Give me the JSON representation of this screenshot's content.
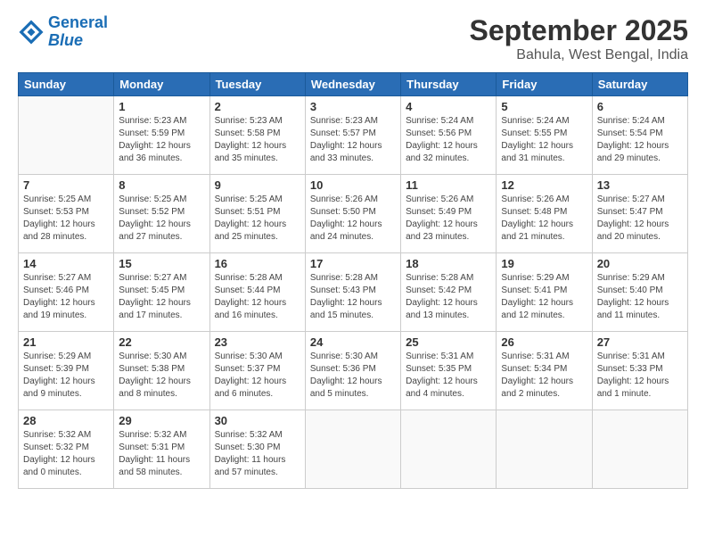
{
  "header": {
    "logo_line1": "General",
    "logo_line2": "Blue",
    "title": "September 2025",
    "subtitle": "Bahula, West Bengal, India"
  },
  "weekdays": [
    "Sunday",
    "Monday",
    "Tuesday",
    "Wednesday",
    "Thursday",
    "Friday",
    "Saturday"
  ],
  "weeks": [
    [
      {
        "num": "",
        "info": ""
      },
      {
        "num": "1",
        "info": "Sunrise: 5:23 AM\nSunset: 5:59 PM\nDaylight: 12 hours\nand 36 minutes."
      },
      {
        "num": "2",
        "info": "Sunrise: 5:23 AM\nSunset: 5:58 PM\nDaylight: 12 hours\nand 35 minutes."
      },
      {
        "num": "3",
        "info": "Sunrise: 5:23 AM\nSunset: 5:57 PM\nDaylight: 12 hours\nand 33 minutes."
      },
      {
        "num": "4",
        "info": "Sunrise: 5:24 AM\nSunset: 5:56 PM\nDaylight: 12 hours\nand 32 minutes."
      },
      {
        "num": "5",
        "info": "Sunrise: 5:24 AM\nSunset: 5:55 PM\nDaylight: 12 hours\nand 31 minutes."
      },
      {
        "num": "6",
        "info": "Sunrise: 5:24 AM\nSunset: 5:54 PM\nDaylight: 12 hours\nand 29 minutes."
      }
    ],
    [
      {
        "num": "7",
        "info": "Sunrise: 5:25 AM\nSunset: 5:53 PM\nDaylight: 12 hours\nand 28 minutes."
      },
      {
        "num": "8",
        "info": "Sunrise: 5:25 AM\nSunset: 5:52 PM\nDaylight: 12 hours\nand 27 minutes."
      },
      {
        "num": "9",
        "info": "Sunrise: 5:25 AM\nSunset: 5:51 PM\nDaylight: 12 hours\nand 25 minutes."
      },
      {
        "num": "10",
        "info": "Sunrise: 5:26 AM\nSunset: 5:50 PM\nDaylight: 12 hours\nand 24 minutes."
      },
      {
        "num": "11",
        "info": "Sunrise: 5:26 AM\nSunset: 5:49 PM\nDaylight: 12 hours\nand 23 minutes."
      },
      {
        "num": "12",
        "info": "Sunrise: 5:26 AM\nSunset: 5:48 PM\nDaylight: 12 hours\nand 21 minutes."
      },
      {
        "num": "13",
        "info": "Sunrise: 5:27 AM\nSunset: 5:47 PM\nDaylight: 12 hours\nand 20 minutes."
      }
    ],
    [
      {
        "num": "14",
        "info": "Sunrise: 5:27 AM\nSunset: 5:46 PM\nDaylight: 12 hours\nand 19 minutes."
      },
      {
        "num": "15",
        "info": "Sunrise: 5:27 AM\nSunset: 5:45 PM\nDaylight: 12 hours\nand 17 minutes."
      },
      {
        "num": "16",
        "info": "Sunrise: 5:28 AM\nSunset: 5:44 PM\nDaylight: 12 hours\nand 16 minutes."
      },
      {
        "num": "17",
        "info": "Sunrise: 5:28 AM\nSunset: 5:43 PM\nDaylight: 12 hours\nand 15 minutes."
      },
      {
        "num": "18",
        "info": "Sunrise: 5:28 AM\nSunset: 5:42 PM\nDaylight: 12 hours\nand 13 minutes."
      },
      {
        "num": "19",
        "info": "Sunrise: 5:29 AM\nSunset: 5:41 PM\nDaylight: 12 hours\nand 12 minutes."
      },
      {
        "num": "20",
        "info": "Sunrise: 5:29 AM\nSunset: 5:40 PM\nDaylight: 12 hours\nand 11 minutes."
      }
    ],
    [
      {
        "num": "21",
        "info": "Sunrise: 5:29 AM\nSunset: 5:39 PM\nDaylight: 12 hours\nand 9 minutes."
      },
      {
        "num": "22",
        "info": "Sunrise: 5:30 AM\nSunset: 5:38 PM\nDaylight: 12 hours\nand 8 minutes."
      },
      {
        "num": "23",
        "info": "Sunrise: 5:30 AM\nSunset: 5:37 PM\nDaylight: 12 hours\nand 6 minutes."
      },
      {
        "num": "24",
        "info": "Sunrise: 5:30 AM\nSunset: 5:36 PM\nDaylight: 12 hours\nand 5 minutes."
      },
      {
        "num": "25",
        "info": "Sunrise: 5:31 AM\nSunset: 5:35 PM\nDaylight: 12 hours\nand 4 minutes."
      },
      {
        "num": "26",
        "info": "Sunrise: 5:31 AM\nSunset: 5:34 PM\nDaylight: 12 hours\nand 2 minutes."
      },
      {
        "num": "27",
        "info": "Sunrise: 5:31 AM\nSunset: 5:33 PM\nDaylight: 12 hours\nand 1 minute."
      }
    ],
    [
      {
        "num": "28",
        "info": "Sunrise: 5:32 AM\nSunset: 5:32 PM\nDaylight: 12 hours\nand 0 minutes."
      },
      {
        "num": "29",
        "info": "Sunrise: 5:32 AM\nSunset: 5:31 PM\nDaylight: 11 hours\nand 58 minutes."
      },
      {
        "num": "30",
        "info": "Sunrise: 5:32 AM\nSunset: 5:30 PM\nDaylight: 11 hours\nand 57 minutes."
      },
      {
        "num": "",
        "info": ""
      },
      {
        "num": "",
        "info": ""
      },
      {
        "num": "",
        "info": ""
      },
      {
        "num": "",
        "info": ""
      }
    ]
  ]
}
